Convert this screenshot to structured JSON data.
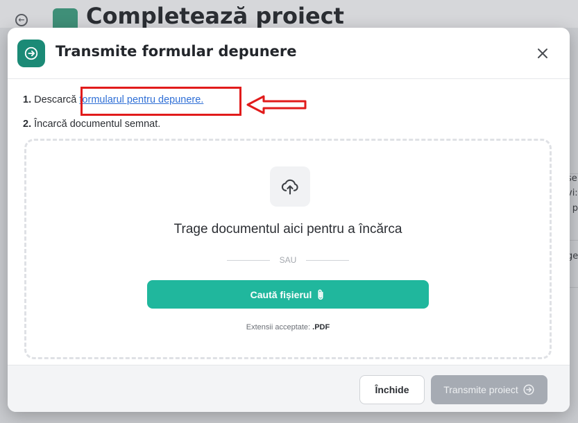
{
  "background": {
    "page_title": "Completează proiect",
    "side_snippets": [
      "se",
      "vi:",
      "i p",
      "ge"
    ]
  },
  "modal": {
    "title": "Transmite formular depunere",
    "icon": "arrow-right-circle-icon",
    "step1": {
      "number": "1.",
      "text": "Descarcă ",
      "link": "formularul pentru depunere."
    },
    "step2": {
      "number": "2.",
      "text": "Încarcă documentul semnat."
    },
    "dropzone": {
      "icon": "cloud-upload-icon",
      "text": "Trage documentul aici pentru a încărca",
      "or": "SAU",
      "browse_label": "Caută fișierul",
      "browse_icon": "paperclip-icon",
      "extensions_label": "Extensii acceptate: ",
      "extensions_value": ".PDF"
    },
    "footer": {
      "close_label": "Închide",
      "submit_label": "Transmite proiect",
      "submit_enabled": false
    }
  },
  "colors": {
    "accent": "#20b79d",
    "brand": "#1b8a76",
    "link": "#2f6fd6",
    "highlight": "#e11b1b",
    "disabled": "#a6abb3"
  }
}
